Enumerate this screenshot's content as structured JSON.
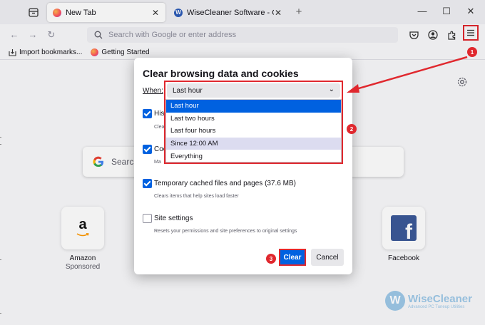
{
  "tabs": [
    {
      "title": "New Tab",
      "active": true
    },
    {
      "title": "WiseCleaner Software - Optimi",
      "active": false
    }
  ],
  "urlbar": {
    "placeholder": "Search with Google or enter address"
  },
  "bookmarks": [
    {
      "label": "Import bookmarks...",
      "icon": "import-icon"
    },
    {
      "label": "Getting Started",
      "icon": "firefox-icon"
    }
  ],
  "newtab": {
    "search_label": "Search",
    "shortcuts": [
      {
        "name": "Amazon",
        "sub": "Sponsored"
      },
      {
        "name": "Facebook",
        "sub": ""
      }
    ]
  },
  "dialog": {
    "title": "Clear browsing data and cookies",
    "when_label": "When:",
    "when_value": "Last hour",
    "options": [
      {
        "label": "His",
        "desc": "Clea",
        "checked": true
      },
      {
        "label": "Coo",
        "desc": "Ma",
        "checked": true
      },
      {
        "label": "Temporary cached files and pages (37.6 MB)",
        "desc": "Clears items that help sites load faster",
        "checked": true
      },
      {
        "label": "Site settings",
        "desc": "Resets your permissions and site preferences to original settings",
        "checked": false
      }
    ],
    "clear_label": "Clear",
    "cancel_label": "Cancel"
  },
  "dropdown": {
    "items": [
      "Last hour",
      "Last two hours",
      "Last four hours",
      "Since 12:00 AM",
      "Everything"
    ],
    "selected_index": 0,
    "hover_index": 3
  },
  "annotations": {
    "b1": "1",
    "b2": "2",
    "b3": "3"
  },
  "watermark": {
    "name": "WiseCleaner",
    "tagline": "Advanced PC Tuneup Utilities",
    "letter": "W"
  },
  "colors": {
    "accent": "#0061e0",
    "annotation": "#e0282e"
  }
}
